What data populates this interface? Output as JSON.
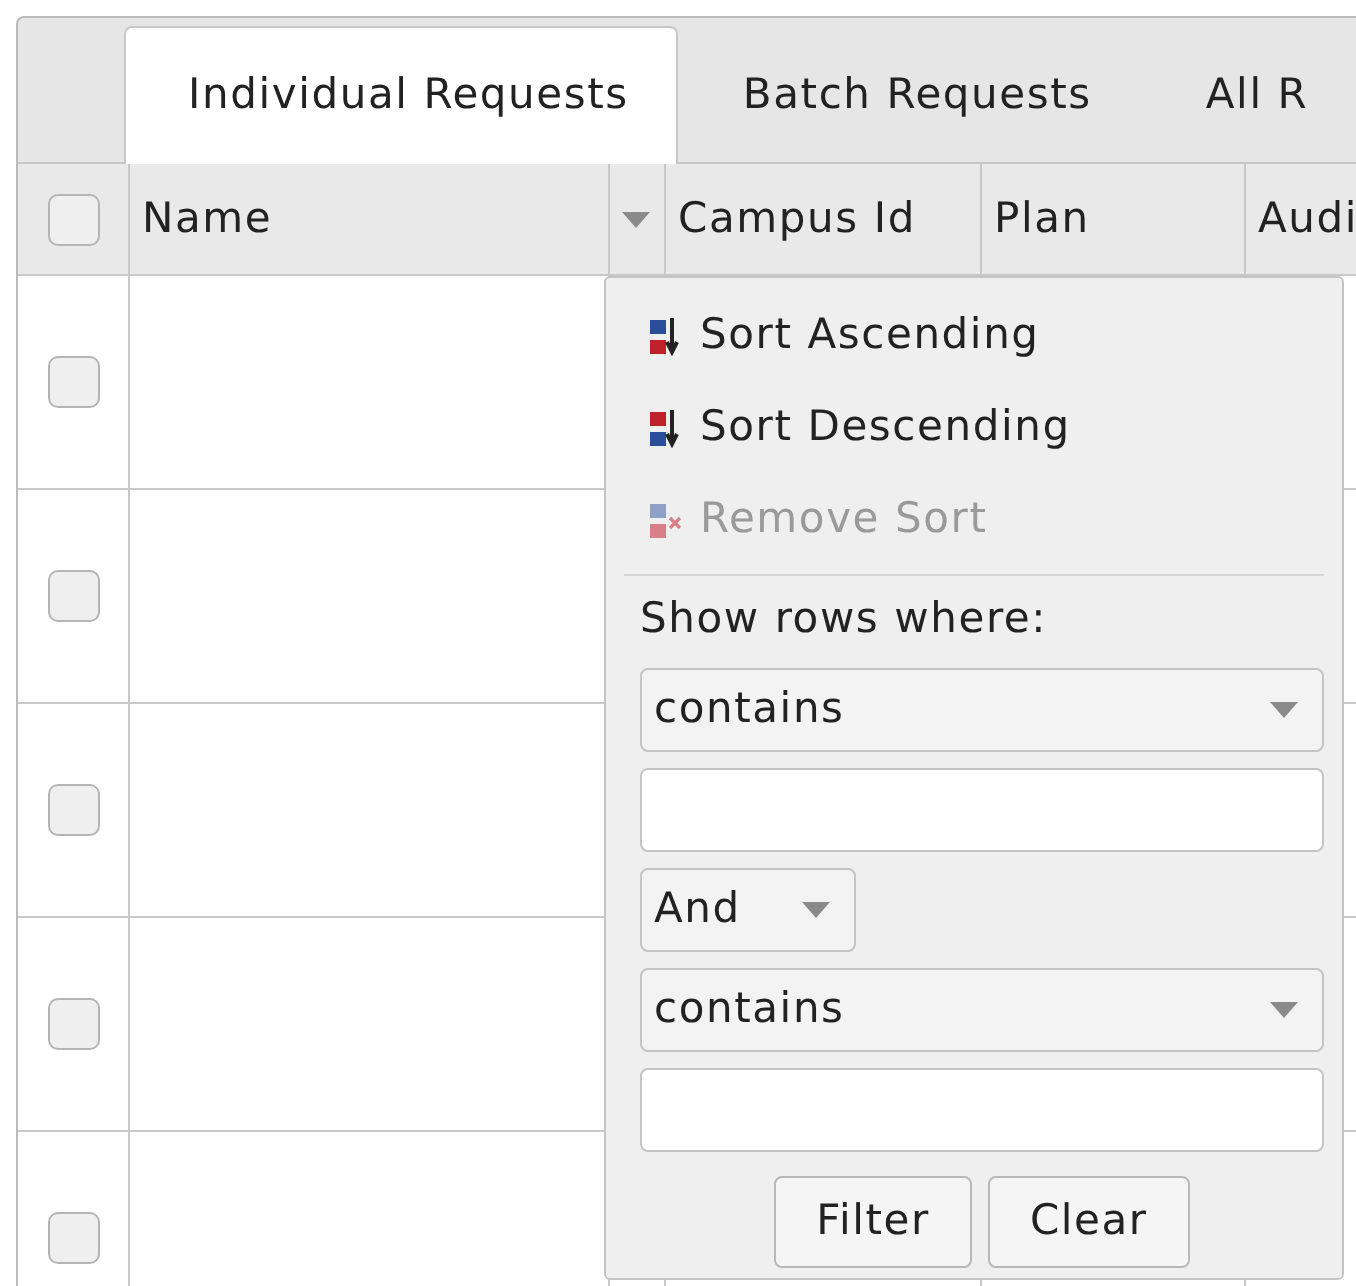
{
  "tabs": [
    {
      "label": "Individual Requests",
      "selected": true
    },
    {
      "label": "Batch Requests",
      "selected": false
    },
    {
      "label": "All R",
      "selected": false
    }
  ],
  "table": {
    "select_all": {
      "checked": false
    },
    "columns": [
      {
        "label": "Name"
      },
      {
        "label": "Campus Id"
      },
      {
        "label": "Plan"
      },
      {
        "label": "Audi"
      }
    ],
    "rows": [
      {
        "checked": false
      },
      {
        "checked": false
      },
      {
        "checked": false
      },
      {
        "checked": false
      },
      {
        "checked": false
      }
    ]
  },
  "column_menu": {
    "sort_items": [
      {
        "kind": "ascending",
        "label": "Sort Ascending",
        "disabled": false
      },
      {
        "kind": "descending",
        "label": "Sort Descending",
        "disabled": false
      },
      {
        "kind": "remove",
        "label": "Remove Sort",
        "disabled": true
      }
    ],
    "filter_label": "Show rows where:",
    "first_condition": {
      "operator": "contains"
    },
    "join": "And",
    "second_condition": {
      "operator": "contains"
    },
    "buttons": [
      "Filter",
      "Clear"
    ]
  }
}
